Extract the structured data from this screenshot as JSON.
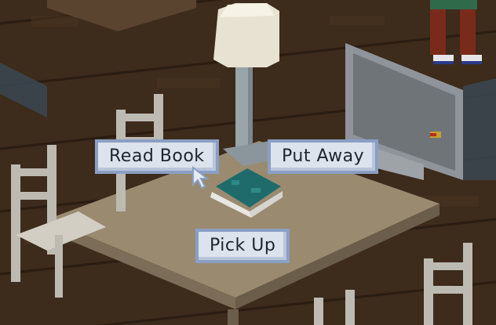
{
  "context_menu": {
    "read_book_label": "Read Book",
    "put_away_label": "Put Away",
    "pick_up_label": "Pick Up"
  },
  "colors": {
    "floor": "#3b2a1a",
    "table": "#9a8a70",
    "menu_bg": "#dde3ec",
    "menu_border": "#8a9fc4",
    "book": "#1f6b6b"
  }
}
